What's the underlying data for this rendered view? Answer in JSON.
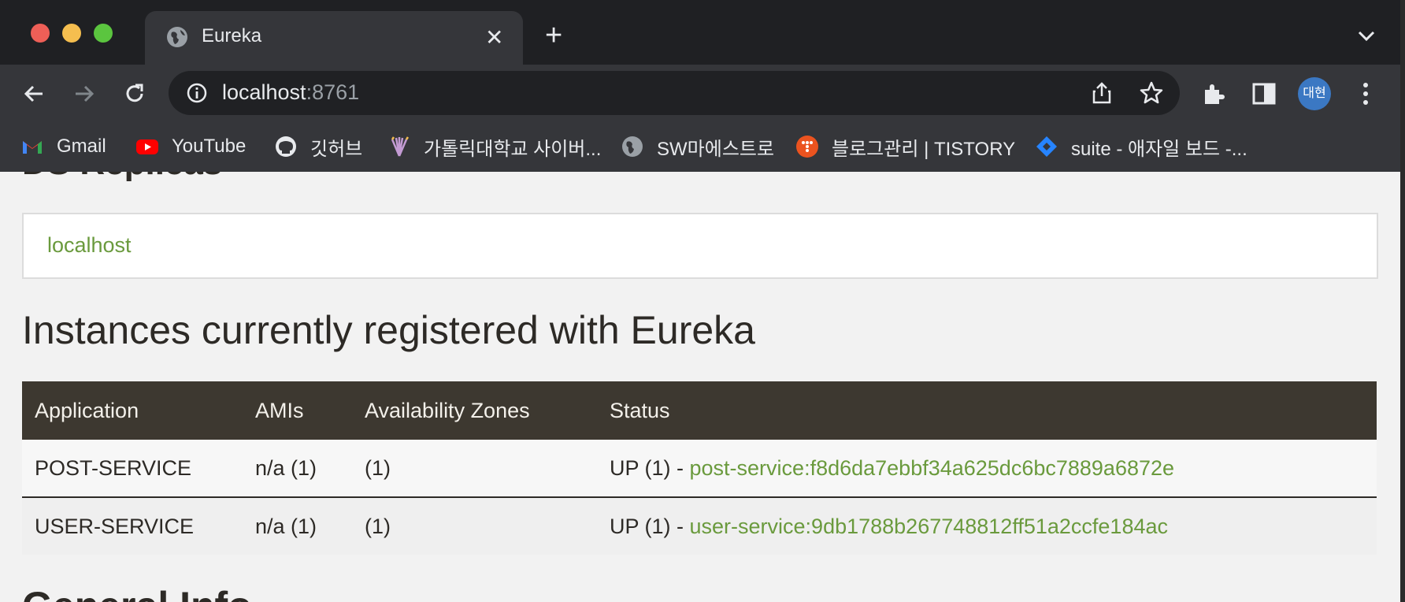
{
  "browser": {
    "tab_title": "Eureka",
    "url_host": "localhost",
    "url_port": ":8761",
    "profile_initials": "대현",
    "icons": [
      "globe-icon",
      "close-icon",
      "plus-icon",
      "chevron-down-icon",
      "back-icon",
      "forward-icon",
      "reload-icon",
      "info-icon",
      "share-icon",
      "star-icon",
      "extensions-icon",
      "sidepanel-icon",
      "kebab-icon"
    ]
  },
  "bookmarks": [
    {
      "label": "Gmail",
      "icon": "gmail-icon"
    },
    {
      "label": "YouTube",
      "icon": "youtube-icon"
    },
    {
      "label": "깃허브",
      "icon": "github-icon"
    },
    {
      "label": "가톨릭대학교 사이버...",
      "icon": "university-icon"
    },
    {
      "label": "SW마에스트로",
      "icon": "globe-icon"
    },
    {
      "label": "블로그관리 | TISTORY",
      "icon": "tistory-icon"
    },
    {
      "label": "suite - 애자일 보드 -...",
      "icon": "jira-icon"
    }
  ],
  "page": {
    "cutoff_heading_top": "DS Replicas",
    "replicas": [
      "localhost"
    ],
    "instances_heading": "Instances currently registered with Eureka",
    "table": {
      "headers": [
        "Application",
        "AMIs",
        "Availability Zones",
        "Status"
      ],
      "rows": [
        {
          "application": "POST-SERVICE",
          "amis": "n/a (1)",
          "zones": "(1)",
          "status_prefix": "UP (1) - ",
          "instance": "post-service:f8d6da7ebbf34a625dc6bc7889a6872e"
        },
        {
          "application": "USER-SERVICE",
          "amis": "n/a (1)",
          "zones": "(1)",
          "status_prefix": "UP (1) - ",
          "instance": "user-service:9db1788b267748812ff51a2ccfe184ac"
        }
      ]
    },
    "cutoff_heading_bottom": "General Info"
  },
  "colors": {
    "link": "#6a9a3d",
    "table_header": "#3d3830",
    "text": "#2d2a26"
  }
}
